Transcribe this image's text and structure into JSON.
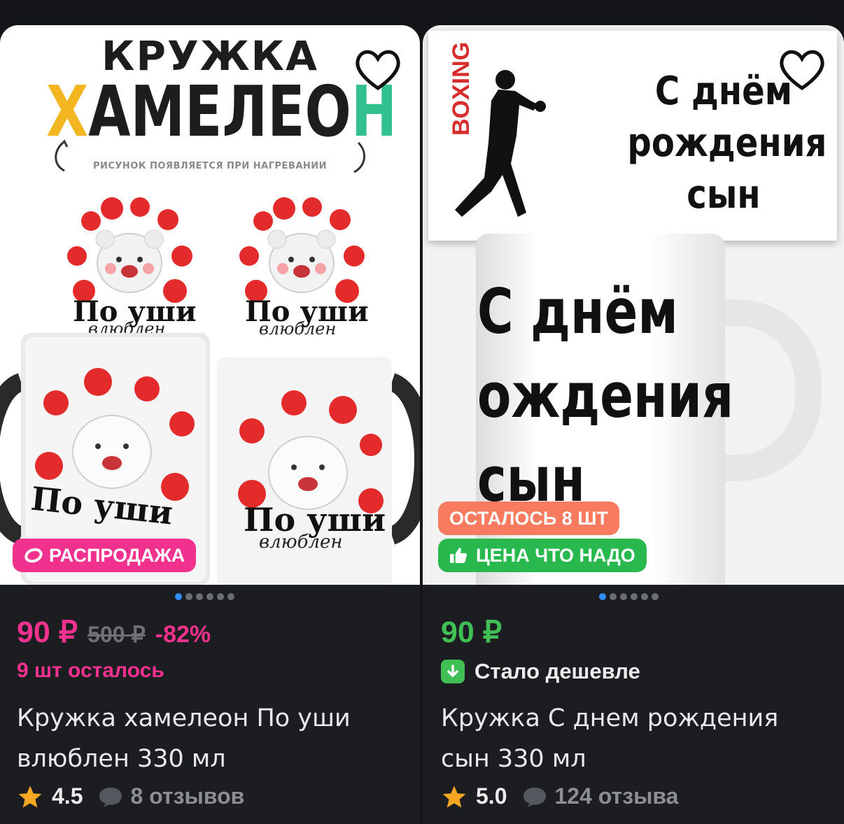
{
  "products": [
    {
      "image_text": {
        "line1": "КРУЖКА",
        "line2": "ХАМЕЛЕОН",
        "subtitle": "РИСУНОК ПОЯВЛЯЕТСЯ ПРИ НАГРЕВАНИИ",
        "print_title": "По уши",
        "print_script": "влюблен"
      },
      "badge": "РАСПРОДАЖА",
      "price": "90 ₽",
      "old_price": "500 ₽",
      "discount": "-82%",
      "stock": "9 шт осталось",
      "title": "Кружка хамелеон По уши влюблен 330 мл",
      "rating": "4.5",
      "reviews": "8 отзывов",
      "carousel_dots": 6,
      "active_dot": 0
    },
    {
      "image_text": {
        "box_vertical": "BOXING",
        "box_lines": [
          "С днём",
          "рождения",
          "сын"
        ],
        "mug_lines": [
          "С днём",
          "ождения",
          "сын"
        ]
      },
      "badge_top": "ОСТАЛОСЬ 8 ШТ",
      "badge": "ЦЕНА ЧТО НАДО",
      "price": "90 ₽",
      "price_note": "Стало дешевле",
      "title": "Кружка С днем рождения сын 330 мл",
      "rating": "5.0",
      "reviews": "124 отзыва",
      "carousel_dots": 6,
      "active_dot": 0
    }
  ],
  "colors": {
    "background": "#141518",
    "card": "#1c1d21",
    "pink": "#f0318d",
    "green": "#3fbf54",
    "orange_badge": "#f87b5f",
    "star": "#f5a623"
  }
}
